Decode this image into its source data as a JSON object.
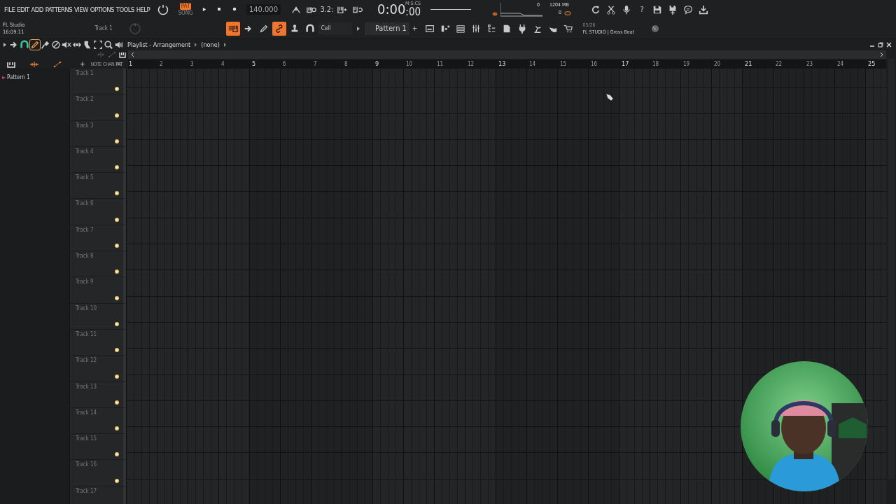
{
  "menu": [
    "FILE",
    "EDIT",
    "ADD",
    "PATTERNS",
    "VIEW",
    "OPTIONS",
    "TOOLS",
    "HELP"
  ],
  "mode": [
    {
      "label": "PAT",
      "selected": true
    },
    {
      "label": "SONG",
      "selected": false
    }
  ],
  "transport": [
    {
      "kind": "play"
    },
    {
      "kind": "stop"
    },
    {
      "kind": "record"
    }
  ],
  "tempo": "140.000",
  "record_tools": [
    {
      "kind": "metronome",
      "on": false
    },
    {
      "kind": "piano-clock",
      "on": false
    },
    {
      "kind": "countdown",
      "label": "3.2:",
      "on": false
    },
    {
      "kind": "piano-plus",
      "on": false
    },
    {
      "kind": "loop",
      "on": false
    }
  ],
  "time": {
    "main": "0:00",
    "centiseconds": ":00",
    "unit": "M:S:CS"
  },
  "monitor": {
    "cpu": "0",
    "memory": "1204 MB",
    "polyphony": "0"
  },
  "shortcuts": [
    {
      "kind": "refresh"
    },
    {
      "kind": "scissors"
    },
    {
      "kind": "mic"
    },
    {
      "kind": "help",
      "label": "?"
    },
    {
      "kind": "save"
    },
    {
      "kind": "save-plus"
    },
    {
      "kind": "chat"
    },
    {
      "kind": "download"
    }
  ],
  "app_name": "FL Studio",
  "clock": "16:09:11",
  "current_track": "Track 1",
  "edit_tools": [
    {
      "kind": "piano-roll",
      "on": true
    },
    {
      "kind": "arrow",
      "on": false
    },
    {
      "kind": "pen",
      "on": false
    },
    {
      "kind": "link",
      "on": true
    },
    {
      "kind": "stamp",
      "on": false
    },
    {
      "kind": "magnet",
      "on": false
    }
  ],
  "snap": "Cell",
  "pattern": "Pattern 1",
  "pattern_add": "+",
  "windows": [
    {
      "kind": "playlist"
    },
    {
      "kind": "steps"
    },
    {
      "kind": "list"
    },
    {
      "kind": "mixer"
    },
    {
      "kind": "tree"
    },
    {
      "kind": "document"
    },
    {
      "kind": "plug"
    },
    {
      "kind": "lamp"
    },
    {
      "kind": "hand"
    },
    {
      "kind": "cart"
    }
  ],
  "hint": {
    "count": "05/26",
    "text": "FL STUDIO | Gross Beat"
  },
  "playlist": {
    "title": "Playlist - Arrangement",
    "arrangement": "(none)",
    "tools": [
      {
        "kind": "arrow",
        "on": false
      },
      {
        "kind": "magnet",
        "on": false
      },
      {
        "kind": "pen",
        "on": true
      },
      {
        "kind": "brush",
        "on": false
      },
      {
        "kind": "delete",
        "on": false
      },
      {
        "kind": "mute",
        "on": false
      },
      {
        "kind": "slip",
        "on": false
      },
      {
        "kind": "slice",
        "on": false
      },
      {
        "kind": "select",
        "on": false
      },
      {
        "kind": "zoom",
        "on": false
      },
      {
        "kind": "speaker",
        "on": false
      }
    ],
    "clip_tabs": [
      {
        "label": "NOTE",
        "selected": false
      },
      {
        "label": "CHAN",
        "selected": false
      },
      {
        "label": "PAT",
        "selected": true
      }
    ],
    "add": "+",
    "patterns": [
      "Pattern 1"
    ],
    "ruler": [
      "1",
      "2",
      "3",
      "4",
      "5",
      "6",
      "7",
      "8",
      "9",
      "10",
      "11",
      "12",
      "13",
      "14",
      "15",
      "16",
      "17",
      "18",
      "19",
      "20",
      "21",
      "22",
      "23",
      "24",
      "25"
    ],
    "tracks": [
      "Track 1",
      "Track 2",
      "Track 3",
      "Track 4",
      "Track 5",
      "Track 6",
      "Track 7",
      "Track 8",
      "Track 9",
      "Track 10",
      "Track 11",
      "Track 12",
      "Track 13",
      "Track 14",
      "Track 15",
      "Track 16",
      "Track 17"
    ]
  }
}
